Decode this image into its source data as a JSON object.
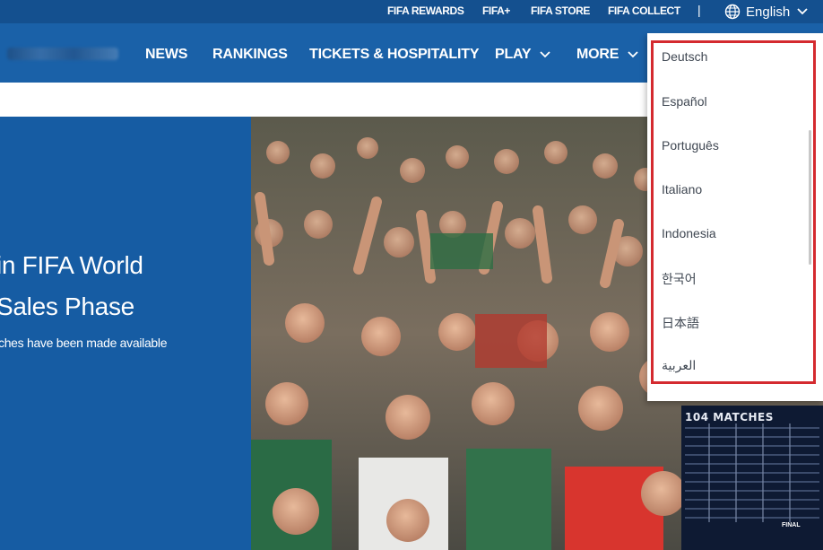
{
  "utility_bar": {
    "links": [
      "FIFA REWARDS",
      "FIFA+",
      "FIFA STORE",
      "FIFA COLLECT"
    ],
    "separator": "|",
    "language_selected": "English"
  },
  "nav": {
    "items": [
      {
        "label": "NEWS"
      },
      {
        "label": "RANKINGS"
      },
      {
        "label": "TICKETS & HOSPITALITY"
      },
      {
        "label": "PLAY"
      },
      {
        "label": "MORE"
      }
    ]
  },
  "hero": {
    "title_line1": "in FIFA World",
    "title_line2": "Sales Phase",
    "subtitle": "ches have been made available"
  },
  "schedule_poster": {
    "title": "104 MATCHES",
    "final_label": "FINAL"
  },
  "language_menu": {
    "options": [
      "Deutsch",
      "Español",
      "Português",
      "Italiano",
      "Indonesia",
      "한국어",
      "日本語",
      "العربية"
    ]
  },
  "colors": {
    "utility_bg": "#14508f",
    "nav_bg": "#1a61a8",
    "hero_bg": "#165ca3",
    "highlight": "#d42a2f"
  },
  "icons": {
    "globe": "globe-icon",
    "chevron": "chevron-down-icon"
  }
}
